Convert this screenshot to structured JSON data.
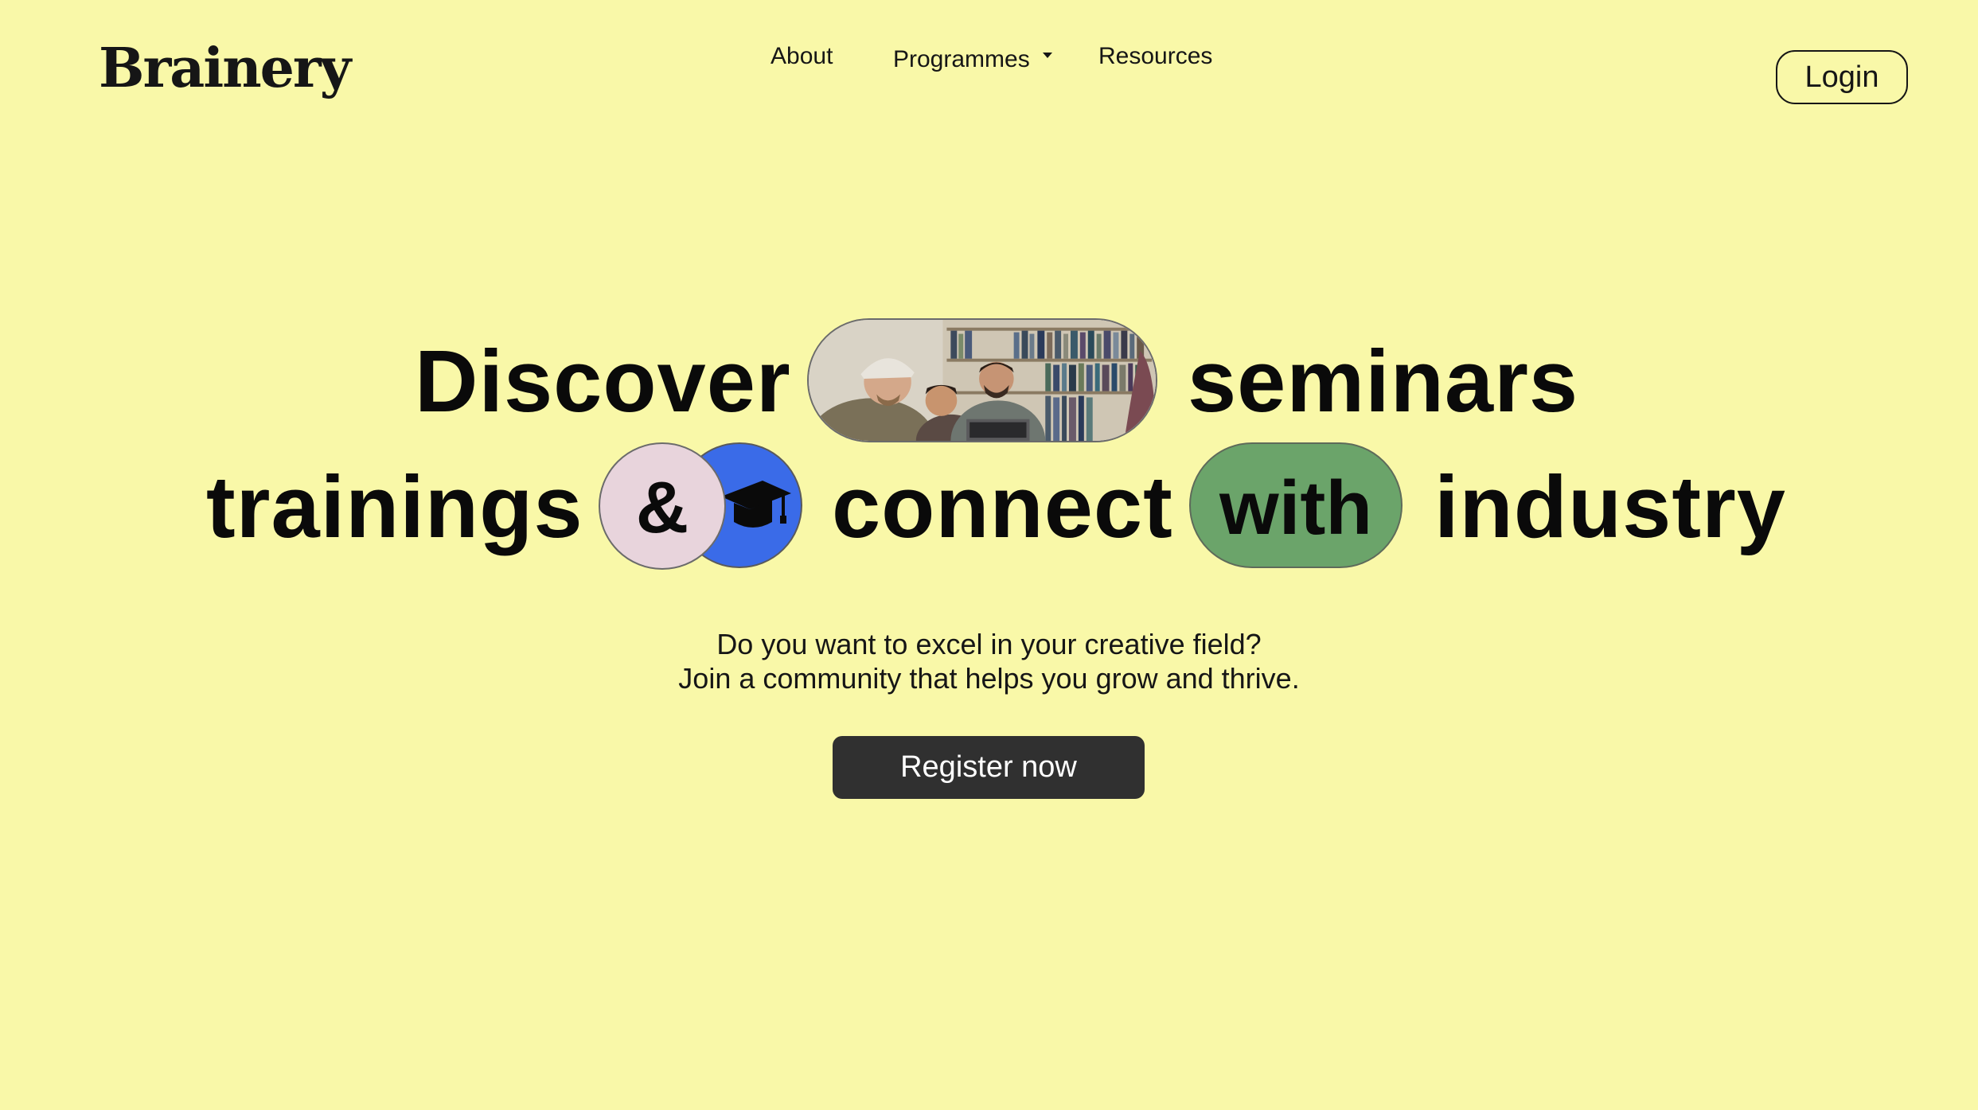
{
  "brand": {
    "logo_text": "Brainery"
  },
  "nav": {
    "items": [
      {
        "label": "About"
      },
      {
        "label": "Programmes"
      },
      {
        "label": "Resources"
      }
    ],
    "login_label": "Login"
  },
  "hero": {
    "line1": {
      "word1": "Discover",
      "word2": "seminars"
    },
    "line2": {
      "word1": "trainings",
      "ampersand": "&",
      "word2": "connect",
      "pill_word": "with",
      "word3": "industry"
    },
    "subtitle_line1": "Do you want to excel in your creative field?",
    "subtitle_line2": "Join a community that helps you grow and thrive.",
    "cta_label": "Register now"
  },
  "colors": {
    "background": "#f9f8a8",
    "accent_blue": "#3a6be8",
    "accent_pink": "#e8d4dc",
    "accent_green": "#6ba46a",
    "button_dark": "#303030"
  },
  "icons": [
    "graduation-cap-icon",
    "chevron-down-icon"
  ]
}
